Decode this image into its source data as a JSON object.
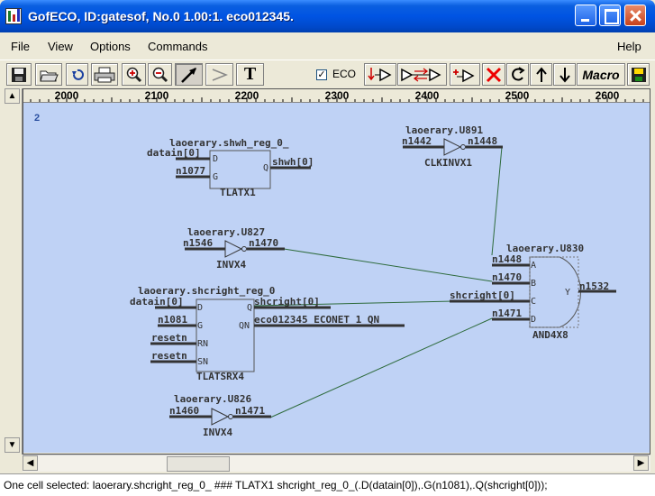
{
  "window": {
    "title": "GofECO, ID:gatesof, No.0 1.00:1. eco012345."
  },
  "menu": {
    "file": "File",
    "view": "View",
    "options": "Options",
    "commands": "Commands",
    "help": "Help"
  },
  "toolbar": {
    "eco_label": "ECO",
    "eco_checked": "✓",
    "macro_label": "Macro",
    "text_tool": "T"
  },
  "ruler": {
    "ticks": [
      "2000",
      "2100",
      "2200",
      "2300",
      "2400",
      "2500",
      "2600"
    ],
    "page_number": "2"
  },
  "schematic": {
    "cells": [
      {
        "instance": "laoerary.shwh_reg_0_",
        "type": "TLATX1",
        "pins_in": [
          "D",
          "G"
        ],
        "pins_out": [
          "Q"
        ],
        "nets_in": [
          "datain[0]",
          "n1077"
        ],
        "nets_out": [
          "shwh[0]"
        ]
      },
      {
        "instance": "laoerary.U891",
        "type": "CLKINVX1",
        "nets_in": [
          "n1442"
        ],
        "nets_out": [
          "n1448"
        ]
      },
      {
        "instance": "laoerary.U827",
        "type": "INVX4",
        "nets_in": [
          "n1546"
        ],
        "nets_out": [
          "n1470"
        ]
      },
      {
        "instance": "laoerary.U830",
        "type": "AND4X8",
        "pins_in": [
          "A",
          "B",
          "C",
          "D"
        ],
        "pins_out": [
          "Y"
        ],
        "nets_in": [
          "n1448",
          "n1470",
          "shcright[0]",
          "n1471"
        ],
        "nets_out": [
          "n1532"
        ]
      },
      {
        "instance": "laoerary.shcright_reg_0",
        "type": "TLATSRX4",
        "pins_in": [
          "D",
          "G",
          "RN",
          "SN"
        ],
        "pins_out": [
          "Q",
          "QN"
        ],
        "nets_in": [
          "datain[0]",
          "n1081",
          "resetn",
          "resetn"
        ],
        "nets_out": [
          "shcright[0]",
          "eco012345_ECONET_1_QN"
        ]
      },
      {
        "instance": "laoerary.U826",
        "type": "INVX4",
        "nets_in": [
          "n1460"
        ],
        "nets_out": [
          "n1471"
        ]
      }
    ]
  },
  "status": {
    "text": "One cell selected: laoerary.shcright_reg_0_ ### TLATX1 shcright_reg_0_(.D(datain[0]),.G(n1081),.Q(shcright[0]));"
  },
  "colors": {
    "canvas_bg": "#BFD2F5",
    "wire": "#2E6B3C",
    "cell_outline": "#555555",
    "net_bar": "#333333"
  }
}
